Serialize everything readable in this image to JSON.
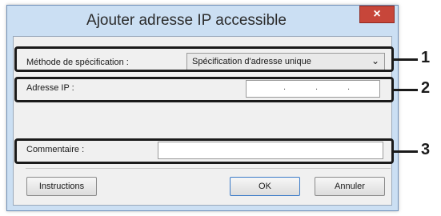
{
  "dialog": {
    "title": "Ajouter adresse IP accessible",
    "close_label": "×"
  },
  "fields": {
    "method_label": "Méthode de spécification :",
    "method_value": "Spécification d'adresse unique",
    "ip_label": "Adresse IP :",
    "ip_value": "",
    "comment_label": "Commentaire :",
    "comment_value": ""
  },
  "buttons": {
    "instructions": "Instructions",
    "ok": "OK",
    "cancel": "Annuler"
  },
  "callouts": {
    "one": "1",
    "two": "2",
    "three": "3"
  },
  "icons": {
    "close": "close-icon",
    "chevron": "chevron-down-icon"
  }
}
